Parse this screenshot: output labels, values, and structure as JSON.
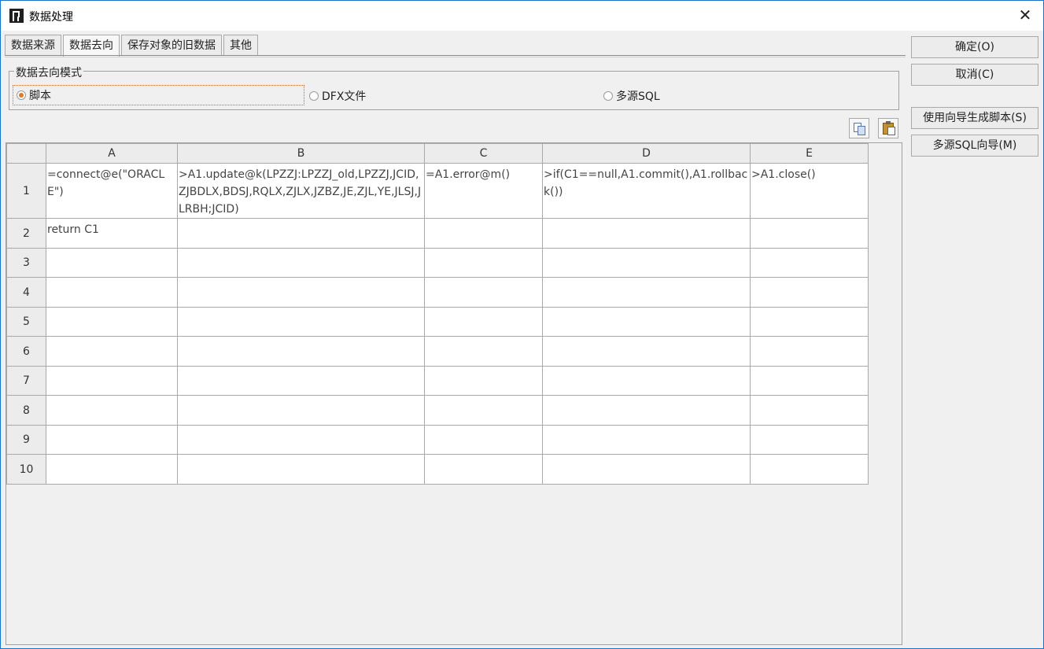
{
  "window": {
    "title": "数据处理",
    "close_label": "✕"
  },
  "tabs": [
    {
      "label": "数据来源",
      "active": false
    },
    {
      "label": "数据去向",
      "active": true
    },
    {
      "label": "保存对象的旧数据",
      "active": false
    },
    {
      "label": "其他",
      "active": false
    }
  ],
  "mode_group": {
    "legend": "数据去向模式",
    "options": [
      {
        "label": "脚本",
        "checked": true
      },
      {
        "label": "DFX文件",
        "checked": false
      },
      {
        "label": "多源SQL",
        "checked": false
      }
    ]
  },
  "toolbar": {
    "copy_icon": "copy-icon",
    "paste_icon": "paste-icon"
  },
  "sheet": {
    "columns": [
      "A",
      "B",
      "C",
      "D",
      "E"
    ],
    "rows": [
      {
        "num": "1",
        "cells": [
          "=connect@e(\"ORACLE\")",
          ">A1.update@k(LPZZJ:LPZZJ_old,LPZZJ,JCID,ZJBDLX,BDSJ,RQLX,ZJLX,JZBZ,JE,ZJL,YE,JLSJ,JLRBH;JCID)",
          "=A1.error@m()",
          ">if(C1==null,A1.commit(),A1.rollback())",
          ">A1.close()"
        ]
      },
      {
        "num": "2",
        "cells": [
          "return C1",
          "",
          "",
          "",
          ""
        ]
      },
      {
        "num": "3",
        "cells": [
          "",
          "",
          "",
          "",
          ""
        ]
      },
      {
        "num": "4",
        "cells": [
          "",
          "",
          "",
          "",
          ""
        ]
      },
      {
        "num": "5",
        "cells": [
          "",
          "",
          "",
          "",
          ""
        ]
      },
      {
        "num": "6",
        "cells": [
          "",
          "",
          "",
          "",
          ""
        ]
      },
      {
        "num": "7",
        "cells": [
          "",
          "",
          "",
          "",
          ""
        ]
      },
      {
        "num": "8",
        "cells": [
          "",
          "",
          "",
          "",
          ""
        ]
      },
      {
        "num": "9",
        "cells": [
          "",
          "",
          "",
          "",
          ""
        ]
      },
      {
        "num": "10",
        "cells": [
          "",
          "",
          "",
          "",
          ""
        ]
      }
    ]
  },
  "buttons": {
    "ok": "确定(O)",
    "cancel": "取消(C)",
    "wizard_script": "使用向导生成脚本(S)",
    "multi_sql_wizard": "多源SQL向导(M)"
  }
}
